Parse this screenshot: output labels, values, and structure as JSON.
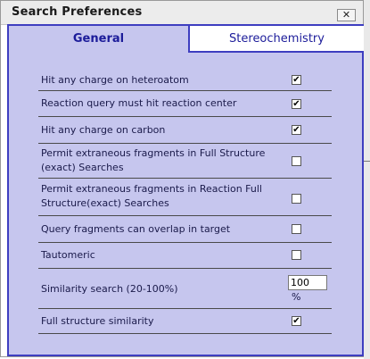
{
  "dialog": {
    "title": "Search Preferences",
    "close_glyph": "✕",
    "tabs": [
      {
        "label": "General",
        "active": true
      },
      {
        "label": "Stereochemistry",
        "active": false
      }
    ]
  },
  "options": [
    {
      "label": "Hit any charge on heteroatom",
      "checked": true
    },
    {
      "label": "Reaction query must hit reaction center",
      "checked": true
    },
    {
      "label": "Hit any charge on carbon",
      "checked": true
    },
    {
      "label": "Permit extraneous fragments in Full Structure (exact) Searches",
      "checked": false
    },
    {
      "label": "Permit extraneous fragments in Reaction Full Structure(exact) Searches",
      "checked": false
    },
    {
      "label": "Query fragments can overlap in target",
      "checked": false
    },
    {
      "label": "Tautomeric",
      "checked": false
    },
    {
      "label": "Similarity search (20-100%)",
      "value": "100",
      "unit": "%"
    },
    {
      "label": "Full structure similarity",
      "checked": true
    }
  ],
  "colors": {
    "panel": "#c6c6ee",
    "accent": "#3e3ec0",
    "tab_text": "#1c1c9a"
  },
  "icons": {
    "close": "close-icon",
    "check": "checkmark-icon"
  }
}
